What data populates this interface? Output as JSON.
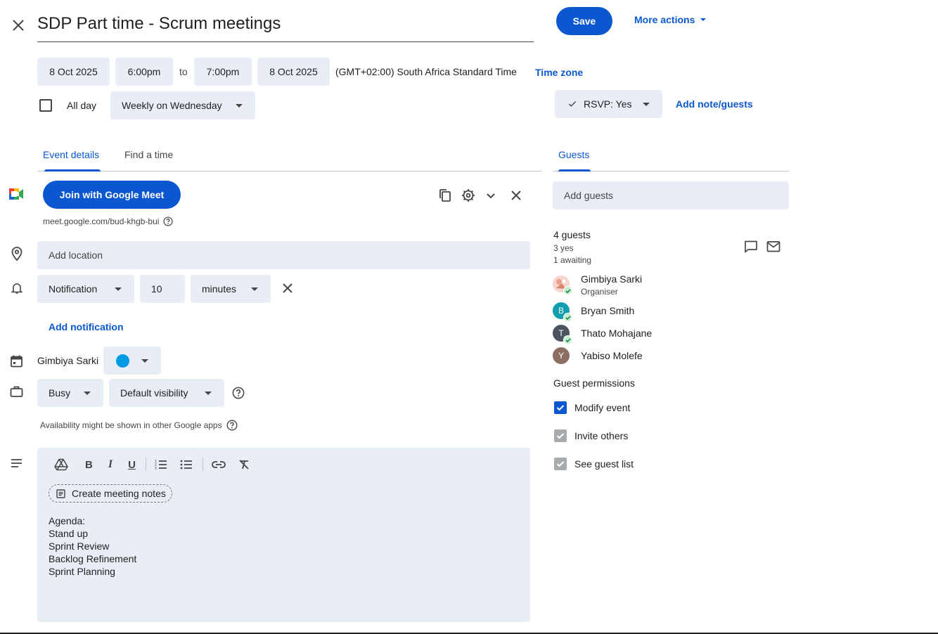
{
  "header": {
    "title": "SDP Part time - Scrum meetings",
    "save_label": "Save",
    "more_actions_label": "More actions"
  },
  "datetime": {
    "start_date": "8 Oct 2025",
    "start_time": "6:00pm",
    "to_label": "to",
    "end_time": "7:00pm",
    "end_date": "8 Oct 2025",
    "timezone_text": "(GMT+02:00) South Africa Standard Time",
    "timezone_link": "Time zone",
    "all_day_label": "All day",
    "all_day_checked": false,
    "recurrence": "Weekly on Wednesday"
  },
  "rsvp": {
    "label": "RSVP: Yes",
    "add_note_label": "Add note/guests"
  },
  "tabs": [
    {
      "label": "Event details",
      "active": true
    },
    {
      "label": "Find a time",
      "active": false
    }
  ],
  "meet": {
    "join_label": "Join with Google Meet",
    "url": "meet.google.com/bud-khgb-bui"
  },
  "location": {
    "placeholder": "Add location"
  },
  "notification": {
    "type": "Notification",
    "value": "10",
    "unit": "minutes",
    "add_label": "Add notification"
  },
  "calendar": {
    "owner": "Gimbiya Sarki",
    "color": "#039be5"
  },
  "availability": {
    "status": "Busy",
    "visibility": "Default visibility",
    "note": "Availability might be shown in other Google apps"
  },
  "description": {
    "create_notes_label": "Create meeting notes",
    "lines": [
      "Agenda:",
      "Stand up",
      "Sprint Review",
      "Backlog Refinement",
      "Sprint Planning"
    ]
  },
  "guests": {
    "tab_label": "Guests",
    "add_placeholder": "Add guests",
    "count_label": "4 guests",
    "yes_label": "3 yes",
    "awaiting_label": "1 awaiting",
    "list": [
      {
        "name": "Gimbiya Sarki",
        "role": "Organiser",
        "initial": "",
        "color": "#f4cccc",
        "accepted": true
      },
      {
        "name": "Bryan Smith",
        "role": "",
        "initial": "B",
        "color": "#129eaf",
        "accepted": true
      },
      {
        "name": "Thato Mohajane",
        "role": "",
        "initial": "T",
        "color": "#4a5560",
        "accepted": true
      },
      {
        "name": "Yabiso Molefe",
        "role": "",
        "initial": "Y",
        "color": "#8d6e63",
        "accepted": false
      }
    ],
    "permissions_title": "Guest permissions",
    "permissions": [
      {
        "label": "Modify event",
        "checked": true,
        "enabled": true
      },
      {
        "label": "Invite others",
        "checked": true,
        "enabled": false
      },
      {
        "label": "See guest list",
        "checked": true,
        "enabled": false
      }
    ]
  },
  "colors": {
    "accent": "#0b57d0",
    "field_bg": "#e9eef6"
  }
}
